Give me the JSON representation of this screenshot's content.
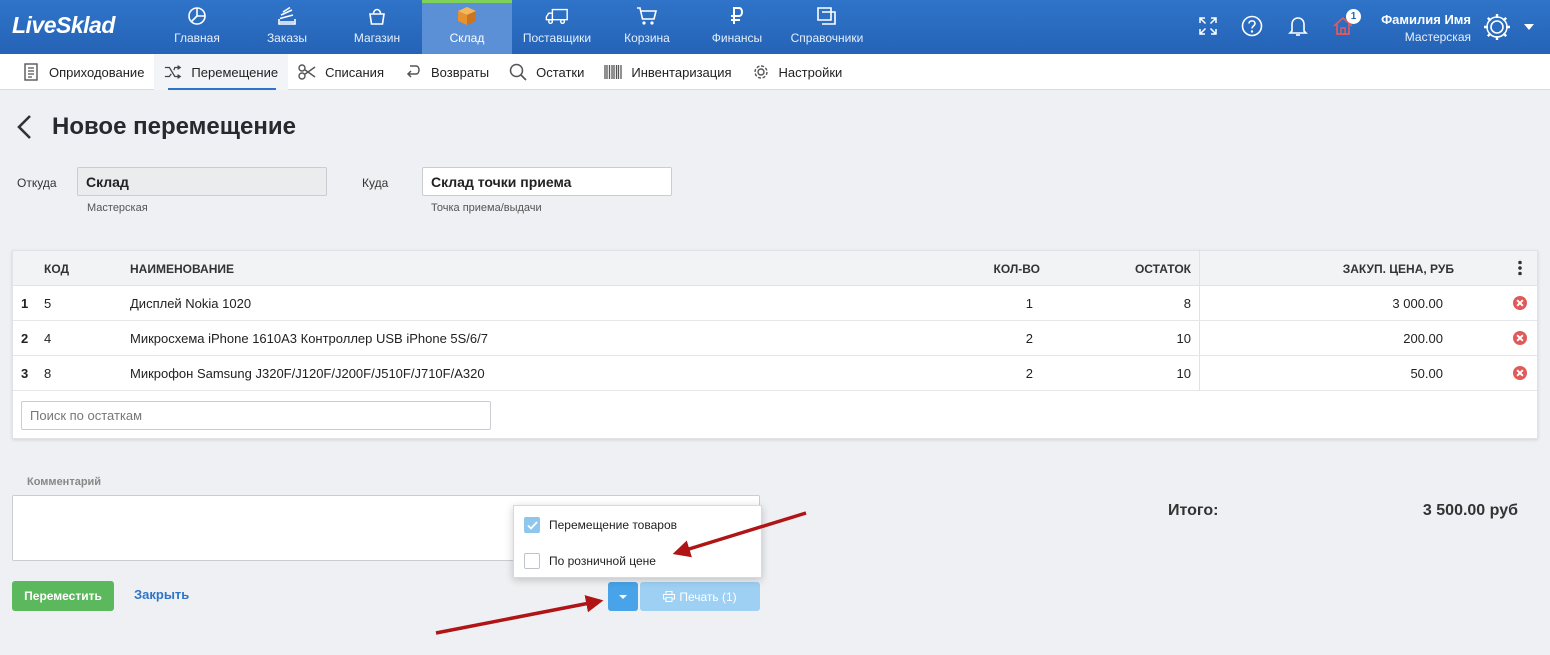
{
  "header": {
    "logo": "LiveSklad",
    "nav": [
      {
        "label": "Главная",
        "icon": "chart-pie-icon"
      },
      {
        "label": "Заказы",
        "icon": "stack-icon"
      },
      {
        "label": "Магазин",
        "icon": "shopping-bag-icon"
      },
      {
        "label": "Склад",
        "icon": "box-icon",
        "active": true
      },
      {
        "label": "Поставщики",
        "icon": "truck-icon"
      },
      {
        "label": "Корзина",
        "icon": "cart-icon"
      },
      {
        "label": "Финансы",
        "icon": "ruble-icon"
      },
      {
        "label": "Справочники",
        "icon": "book-icon"
      }
    ],
    "notification_count": "1",
    "user": {
      "name": "Фамилия Имя",
      "role": "Мастерская"
    }
  },
  "subnav": [
    {
      "label": "Оприходование",
      "icon": "receipt-icon"
    },
    {
      "label": "Перемещение",
      "icon": "shuffle-icon",
      "active": true
    },
    {
      "label": "Списания",
      "icon": "scissors-icon"
    },
    {
      "label": "Возвраты",
      "icon": "return-icon"
    },
    {
      "label": "Остатки",
      "icon": "search-icon"
    },
    {
      "label": "Инвентаризация",
      "icon": "barcode-icon"
    },
    {
      "label": "Настройки",
      "icon": "gear-icon"
    }
  ],
  "page": {
    "title": "Новое перемещение",
    "from": {
      "label": "Откуда",
      "value": "Склад",
      "hint": "Мастерская"
    },
    "to": {
      "label": "Куда",
      "value": "Склад точки приема",
      "hint": "Точка приема/выдачи"
    }
  },
  "table": {
    "columns": {
      "code": "КОД",
      "name": "НАИМЕНОВАНИЕ",
      "qty": "КОЛ-ВО",
      "stock": "ОСТАТОК",
      "price": "ЗАКУП. ЦЕНА, РУБ"
    },
    "rows": [
      {
        "n": "1",
        "code": "5",
        "name": "Дисплей Nokia 1020",
        "qty": "1",
        "stock": "8",
        "price": "3 000.00"
      },
      {
        "n": "2",
        "code": "4",
        "name": "Микросхема iPhone 1610A3 Контроллер USB iPhone 5S/6/7",
        "qty": "2",
        "stock": "10",
        "price": "200.00"
      },
      {
        "n": "3",
        "code": "8",
        "name": "Микрофон Samsung J320F/J120F/J200F/J510F/J710F/A320",
        "qty": "2",
        "stock": "10",
        "price": "50.00"
      }
    ],
    "search_placeholder": "Поиск по остаткам"
  },
  "comment": {
    "label": "Комментарий",
    "value": ""
  },
  "total": {
    "label": "Итого:",
    "value": "3 500.00 руб"
  },
  "actions": {
    "move": "Переместить",
    "close": "Закрыть",
    "print": "Печать (1)"
  },
  "print_menu": [
    {
      "label": "Перемещение товаров",
      "checked": true
    },
    {
      "label": "По розничной цене",
      "checked": false
    }
  ],
  "colors": {
    "header": "#2f74c9",
    "accent": "#2f74c9",
    "success": "#5cb85c",
    "danger": "#e05a5a",
    "annotation_arrow": "#b01414"
  }
}
